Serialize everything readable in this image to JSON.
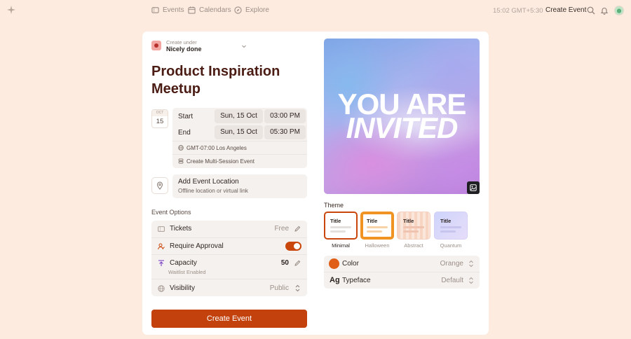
{
  "nav": {
    "events": "Events",
    "calendars": "Calendars",
    "explore": "Explore",
    "time": "15:02 GMT+5:30",
    "create_event": "Create Event"
  },
  "create_under": {
    "label": "Create under",
    "value": "Nicely done"
  },
  "event_title": "Product Inspiration Meetup",
  "date_badge": {
    "month": "OCT",
    "day": "15"
  },
  "schedule": {
    "start_label": "Start",
    "start_date": "Sun, 15 Oct",
    "start_time": "03:00 PM",
    "end_label": "End",
    "end_date": "Sun, 15 Oct",
    "end_time": "05:30 PM",
    "timezone": "GMT-07:00 Los Angeles",
    "multi_session": "Create Multi-Session Event"
  },
  "location": {
    "title": "Add Event Location",
    "subtitle": "Offline location or virtual link"
  },
  "options": {
    "heading": "Event Options",
    "tickets_label": "Tickets",
    "tickets_value": "Free",
    "approval_label": "Require Approval",
    "approval_enabled": true,
    "capacity_label": "Capacity",
    "capacity_value": "50",
    "capacity_sub": "Waitlist Enabled",
    "visibility_label": "Visibility",
    "visibility_value": "Public"
  },
  "create_button": "Create Event",
  "invite": {
    "line1": "YOU ARE",
    "line2": "INVITED"
  },
  "theme": {
    "heading": "Theme",
    "card_title": "Title",
    "items": [
      {
        "label": "Minimal",
        "selected": true
      },
      {
        "label": "Halloween",
        "selected": false
      },
      {
        "label": "Abstract",
        "selected": false
      },
      {
        "label": "Quantum",
        "selected": false
      }
    ]
  },
  "customize": {
    "color_label": "Color",
    "color_value": "Orange",
    "color_hex": "#e05d17",
    "typeface_icon": "Ag",
    "typeface_label": "Typeface",
    "typeface_value": "Default"
  },
  "colors": {
    "accent": "#c2410c",
    "background": "#fcebde",
    "title": "#4a1c14"
  }
}
